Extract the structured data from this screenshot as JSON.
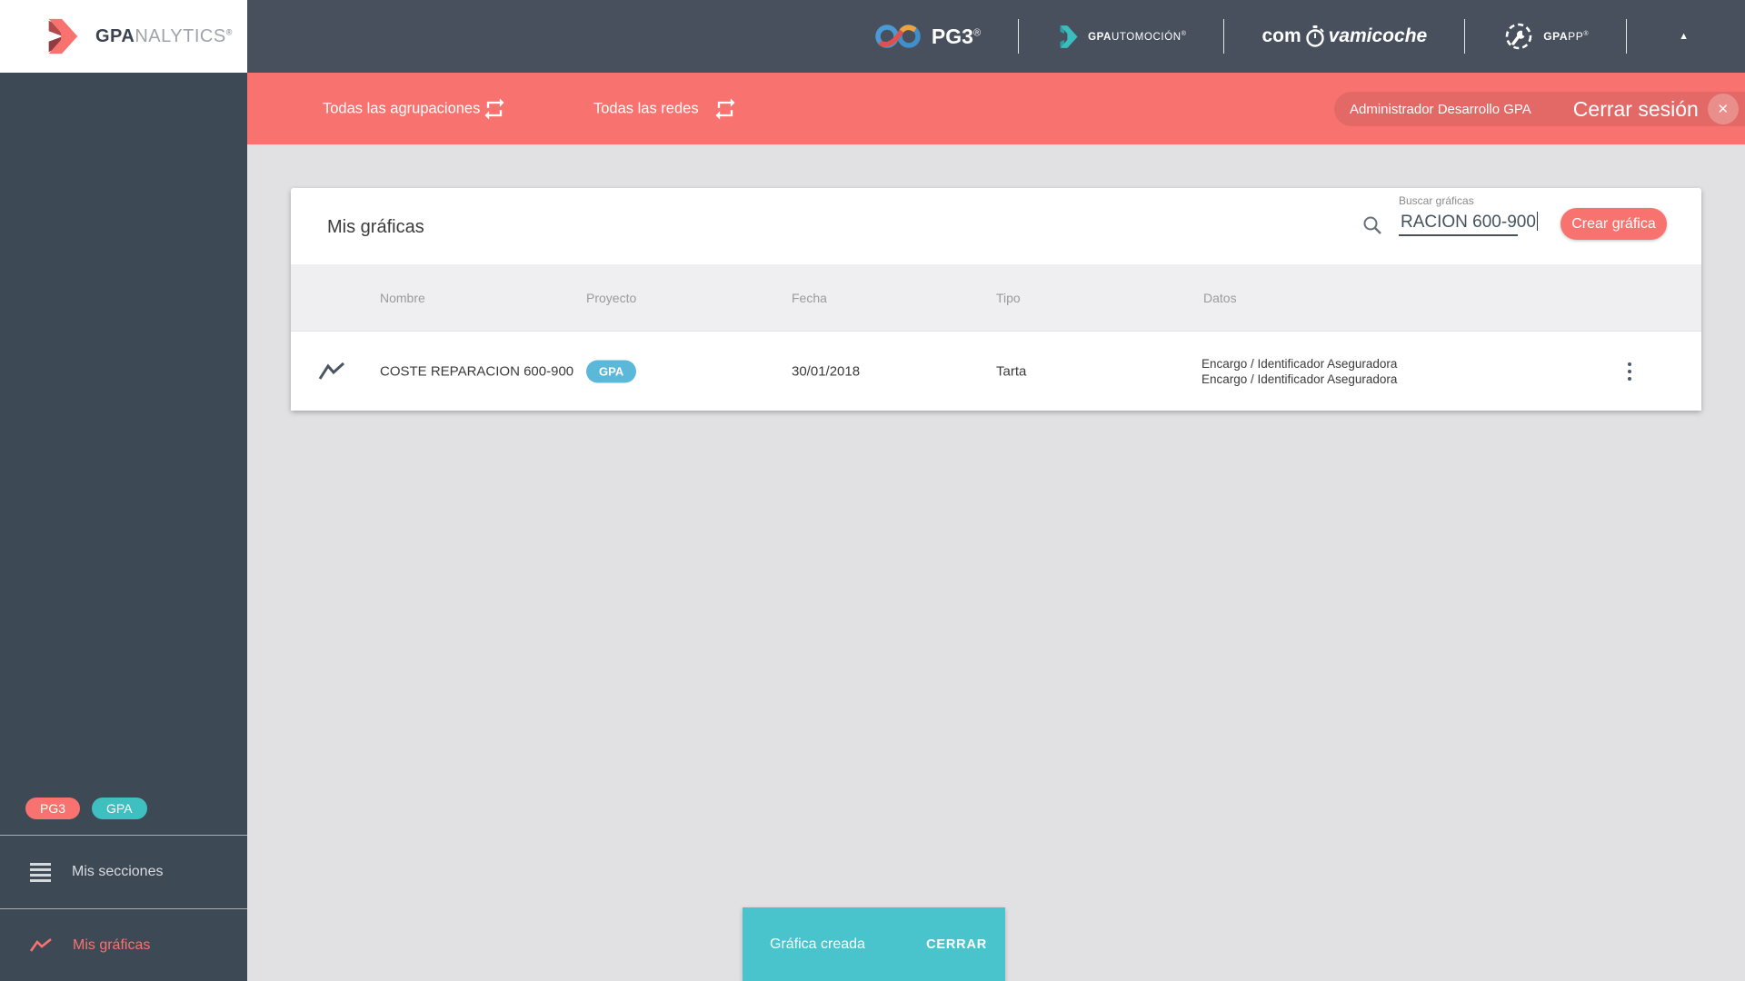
{
  "sidebar": {
    "logo": {
      "bold": "GPA",
      "light": "NALYTICS",
      "reg": "®"
    },
    "badges": [
      {
        "label": "PG3"
      },
      {
        "label": "GPA"
      }
    ],
    "items": [
      {
        "label": "Mis secciones"
      },
      {
        "label": "Mis gráficas"
      }
    ]
  },
  "topbar": {
    "pg3": {
      "label": "PG3",
      "reg": "®"
    },
    "automocion": {
      "bold": "GPA",
      "rest": "UTOMOCIÓN",
      "reg": "®"
    },
    "comprova": {
      "pre": "com",
      "post": "vamicoche"
    },
    "gpapp": {
      "bold": "GPA",
      "rest": "PP",
      "reg": "®"
    },
    "caret": "▲"
  },
  "filterbar": {
    "groupings": "Todas las agrupaciones",
    "networks": "Todas las redes",
    "user": "Administrador Desarrollo GPA",
    "logout": "Cerrar sesión",
    "logout_x": "✕"
  },
  "card": {
    "title": "Mis gráficas",
    "search": {
      "label": "Buscar gráficas",
      "value": "RACION 600-900"
    },
    "create_button": "Crear gráfica",
    "table": {
      "headers": [
        "Nombre",
        "Proyecto",
        "Fecha",
        "Tipo",
        "Datos"
      ],
      "rows": [
        {
          "name": "COSTE REPARACION 600-900",
          "project": "GPA",
          "date": "30/01/2018",
          "type": "Tarta",
          "data_line1": "Encargo / Identificador Aseguradora",
          "data_line2": "Encargo / Identificador Aseguradora"
        }
      ]
    }
  },
  "snackbar": {
    "message": "Gráfica creada",
    "action": "CERRAR"
  },
  "colors": {
    "accent": "#f8736f",
    "topbar": "#48505e",
    "sidebar": "#3e4956",
    "project_badge": "#5cb8d8",
    "sidebar_gpa_badge": "#3fc0c0",
    "snackbar": "#49c4cc",
    "page_bg": "#e1e1e3"
  }
}
